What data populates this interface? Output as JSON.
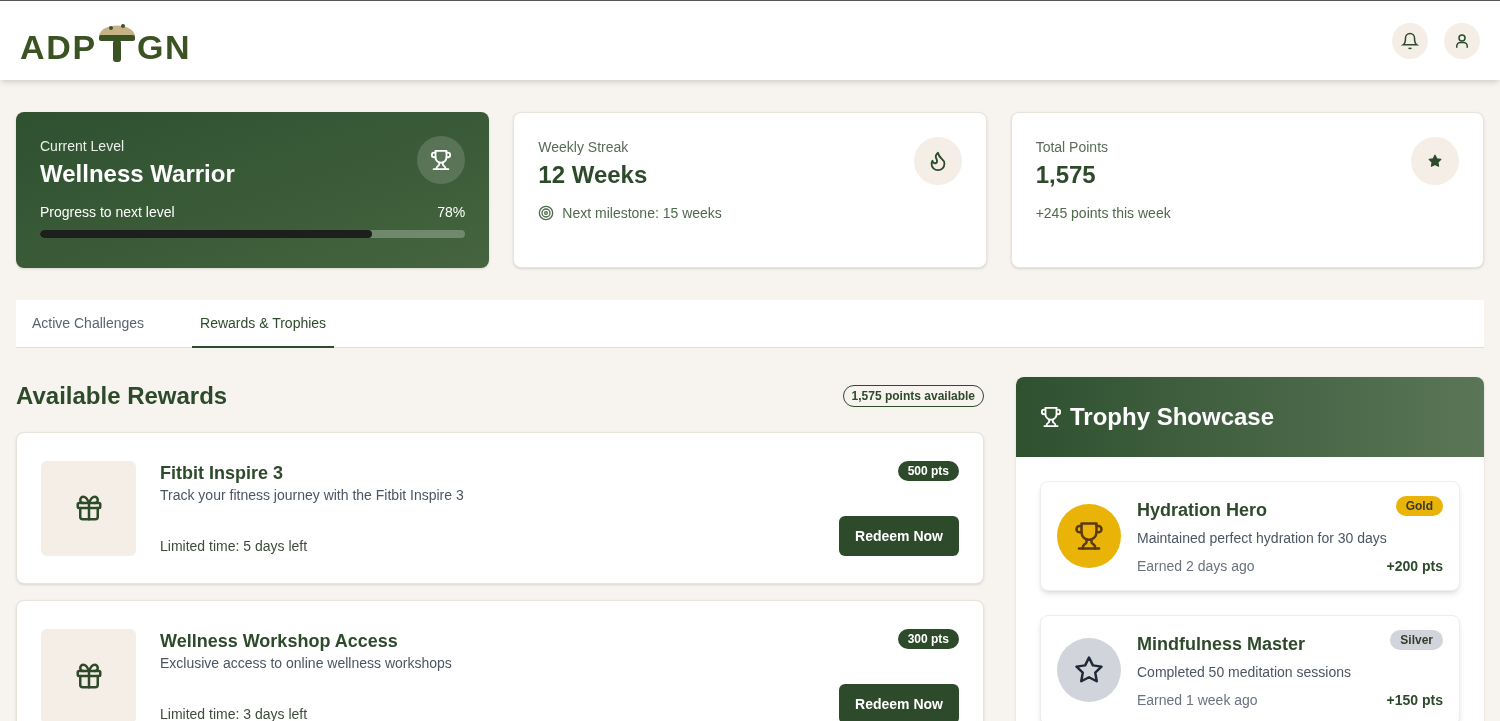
{
  "logo": {
    "before": "ADP",
    "after": "GN"
  },
  "stats": [
    {
      "kind": "level",
      "label": "Current Level",
      "value": "Wellness Warrior",
      "progress_label": "Progress to next level",
      "progress_text": "78%",
      "level": 0.78
    },
    {
      "kind": "streak",
      "label": "Weekly Streak",
      "value": "12 Weeks",
      "note": "Next milestone: 15 weeks"
    },
    {
      "kind": "points",
      "label": "Total Points",
      "value": "1,575",
      "note": "+245 points this week"
    }
  ],
  "tabs": [
    {
      "label": "Active Challenges",
      "selected": false
    },
    {
      "label": "Rewards & Trophies",
      "selected": true
    }
  ],
  "rewards_section": {
    "title": "Available Rewards",
    "badge": "1,575 points available"
  },
  "rewards": [
    {
      "title": "Fitbit Inspire 3",
      "description": "Track your fitness journey with the Fitbit Inspire 3",
      "note": "Limited time: 5 days left",
      "points": "500 pts",
      "button": "Redeem Now"
    },
    {
      "title": "Wellness Workshop Access",
      "description": "Exclusive access to online wellness workshops",
      "note": "Limited time: 3 days left",
      "points": "300 pts",
      "button": "Redeem Now"
    }
  ],
  "trophy_showcase": {
    "title": "Trophy Showcase"
  },
  "trophies": [
    {
      "kind": "trophy",
      "title": "Hydration Hero",
      "tier": "Gold",
      "color": "#eab308",
      "description": "Maintained perfect hydration for 30 days",
      "earned": "Earned 2 days ago",
      "points": "+200 pts"
    },
    {
      "kind": "star",
      "title": "Mindfulness Master",
      "tier": "Silver",
      "color": "#d1d5db",
      "description": "Completed 50 meditation sessions",
      "earned": "Earned 1 week ago",
      "points": "+150 pts"
    }
  ]
}
